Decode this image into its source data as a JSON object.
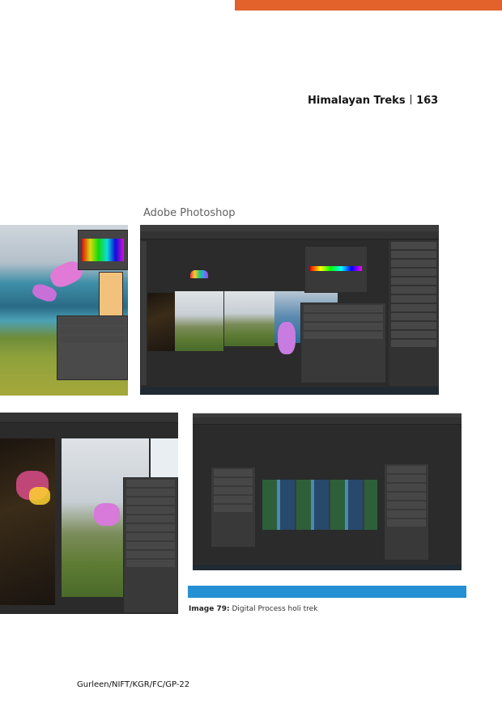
{
  "header": {
    "title": "Himalayan Treks",
    "page_number": "163"
  },
  "section_label": "Adobe Photoshop",
  "caption": {
    "label": "Image 79:",
    "text": "Digital Process holi trek"
  },
  "footer": {
    "code": "Gurleen/NIFT/KGR/FC/GP-22"
  },
  "colors": {
    "accent_orange": "#e3612a",
    "accent_blue": "#2590d4"
  }
}
